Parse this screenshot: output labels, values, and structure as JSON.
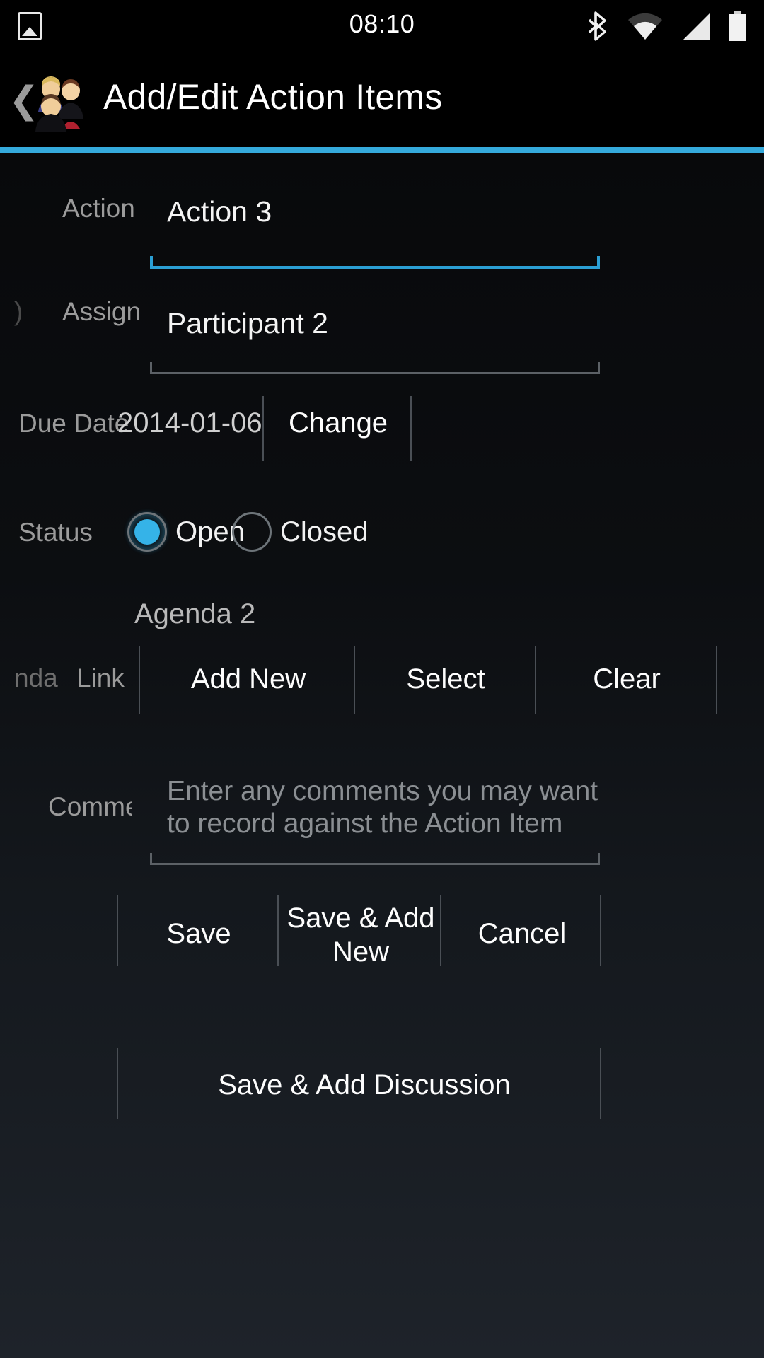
{
  "status_bar": {
    "time": "08:10",
    "icons": [
      "image-icon",
      "bluetooth-icon",
      "wifi-icon",
      "cellular-signal-icon",
      "battery-icon"
    ]
  },
  "app_bar": {
    "title": "Add/Edit Action Items",
    "back_icon": "back-chevron-icon",
    "logo_icon": "people-group-icon",
    "accent_color": "#35aadc"
  },
  "form": {
    "action": {
      "label": "Action",
      "value": "Action 3",
      "focused": true
    },
    "assignee": {
      "label_prefix": ")",
      "label": "Assign",
      "value": "Participant 2",
      "focused": false
    },
    "due_date": {
      "label": "Due Date",
      "value": "2014-01-06",
      "change_label": "Change"
    },
    "status": {
      "label": "Status",
      "options": [
        {
          "label": "Open",
          "selected": true
        },
        {
          "label": "Closed",
          "selected": false
        }
      ]
    },
    "agenda_link": {
      "value": "Agenda 2",
      "label_left": "nda",
      "label": "Link",
      "buttons": [
        "Add New",
        "Select",
        "Clear"
      ]
    },
    "comments": {
      "label": "Comme",
      "placeholder": "Enter any comments you may want to record against the Action Item",
      "value": ""
    }
  },
  "actions": {
    "save": "Save",
    "save_add_new": "Save & Add New",
    "cancel": "Cancel",
    "save_add_discussion": "Save & Add Discussion"
  }
}
